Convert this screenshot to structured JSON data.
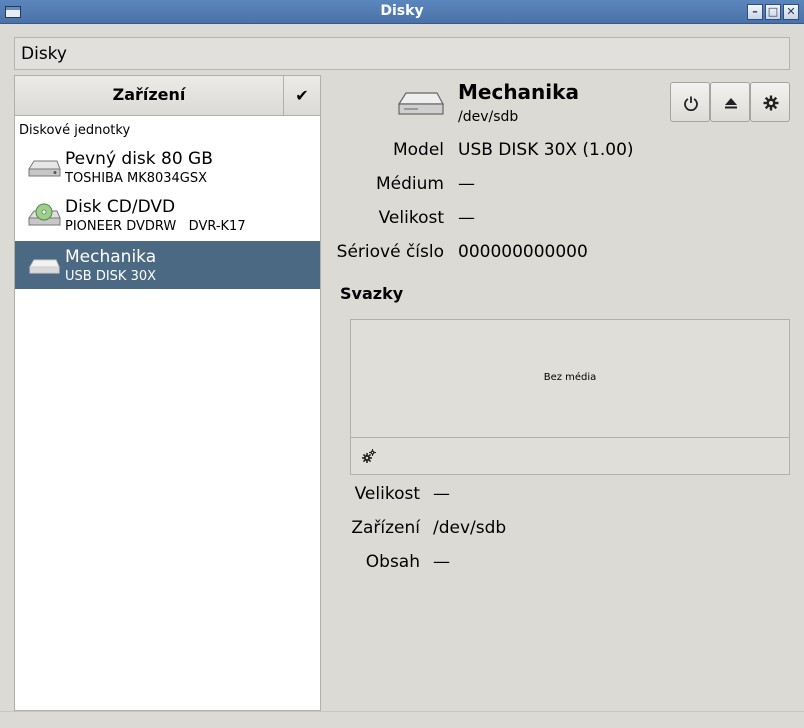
{
  "window": {
    "title": "Disky",
    "app_icon": "window-icon",
    "buttons": {
      "minimize": "minimize-icon",
      "maximize": "maximize-icon",
      "close": "close-icon"
    }
  },
  "header": {
    "title": "Disky"
  },
  "left_pane": {
    "title": "Zařízení",
    "check_icon": "checkmark-icon",
    "section_label": "Diskové jednotky",
    "devices": [
      {
        "name": "Pevný disk 80 GB",
        "sub": "TOSHIBA MK8034GSX",
        "icon": "hard-disk-icon",
        "selected": false
      },
      {
        "name": "Disk CD/DVD",
        "sub": "PIONEER DVDRW   DVR-K17",
        "icon": "optical-drive-icon",
        "selected": false
      },
      {
        "name": "Mechanika",
        "sub": "USB DISK 30X",
        "icon": "usb-drive-icon",
        "selected": true
      }
    ]
  },
  "right_pane": {
    "title": "Mechanika",
    "path": "/dev/sdb",
    "toolbar": [
      "power-icon",
      "eject-icon",
      "gear-icon"
    ],
    "properties": [
      {
        "label": "Model",
        "value": "USB DISK 30X (1.00)"
      },
      {
        "label": "Médium",
        "value": "—"
      },
      {
        "label": "Velikost",
        "value": "—"
      },
      {
        "label": "Sériové číslo",
        "value": "000000000000"
      }
    ],
    "volumes_title": "Svazky",
    "no_media": "Bez média",
    "volume_gear_icon": "gears-icon",
    "volume_properties": [
      {
        "label": "Velikost",
        "value": "—"
      },
      {
        "label": "Zařízení",
        "value": "/dev/sdb"
      },
      {
        "label": "Obsah",
        "value": "—"
      }
    ]
  },
  "colors": {
    "selection": "#4b6983",
    "titlebar": "#5b86bd",
    "background": "#dcdad5"
  }
}
